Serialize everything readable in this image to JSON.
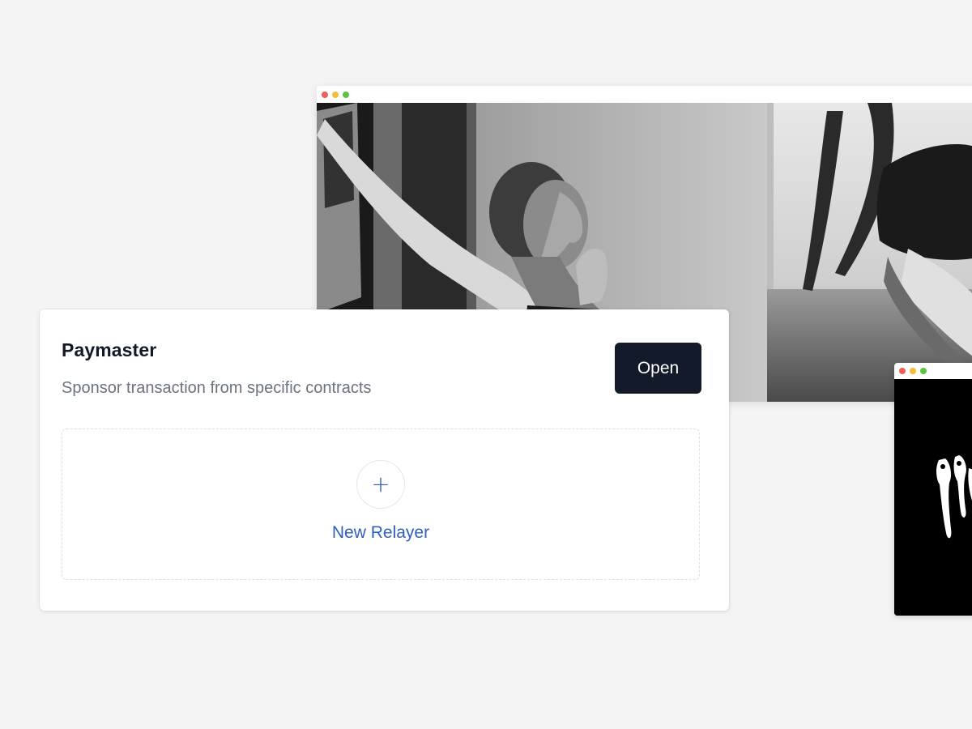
{
  "card": {
    "title": "Paymaster",
    "subtitle": "Sponsor transaction from specific contracts",
    "open_label": "Open"
  },
  "relayer": {
    "icon": "plus-icon",
    "glyph": "+",
    "label": "New Relayer"
  },
  "windows": {
    "main_icon_names": [
      "close-dot-icon",
      "minimize-dot-icon",
      "maximize-dot-icon"
    ],
    "small_icon_names": [
      "close-dot-icon",
      "minimize-dot-icon",
      "maximize-dot-icon"
    ]
  },
  "colors": {
    "background": "#f4f4f4",
    "button_bg": "#131a2a",
    "accent": "#2f5fc4",
    "subtitle": "#6b7280",
    "dot_red": "#ee5f57",
    "dot_yellow": "#f6bd3a",
    "dot_green": "#5ec33d"
  }
}
